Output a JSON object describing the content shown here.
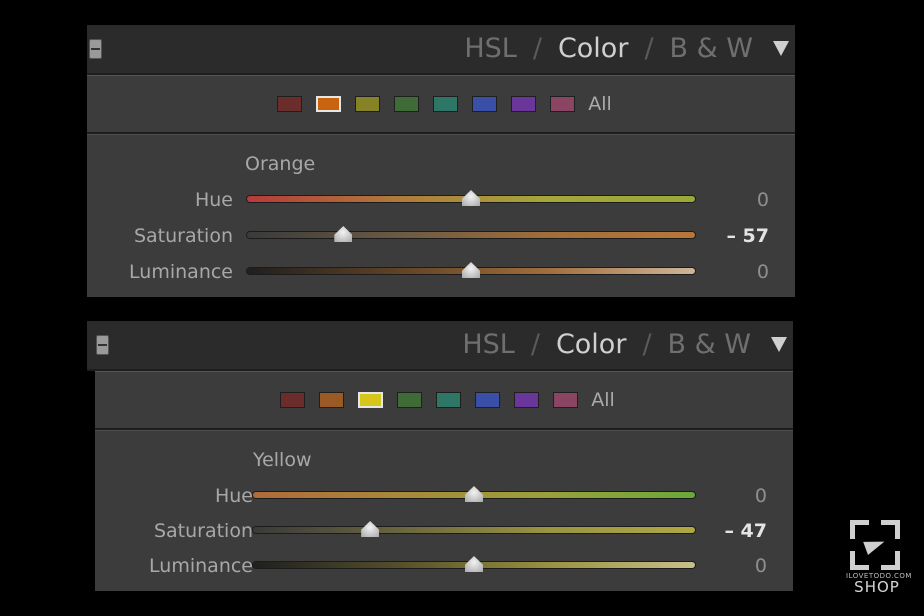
{
  "panels": [
    {
      "tabs": [
        "HSL",
        "Color",
        "B & W"
      ],
      "active_tab": 1,
      "separator": "/",
      "swatches": [
        {
          "color": "#6b2c2c",
          "selected": false
        },
        {
          "color": "#c8630f",
          "selected": true
        },
        {
          "color": "#868226",
          "selected": false
        },
        {
          "color": "#3f6b36",
          "selected": false
        },
        {
          "color": "#2e7766",
          "selected": false
        },
        {
          "color": "#3a4fa8",
          "selected": false
        },
        {
          "color": "#6a3699",
          "selected": false
        },
        {
          "color": "#8a4563",
          "selected": false
        }
      ],
      "all_label": "All",
      "color_name": "Orange",
      "sliders": [
        {
          "label": "Hue",
          "value_text": "0",
          "value": 0,
          "highlight": false,
          "gradient": [
            "#b63a3a",
            "#b07a3a",
            "#a5a63a",
            "#9aa83a"
          ]
        },
        {
          "label": "Saturation",
          "value_text": "– 57",
          "value": -57,
          "highlight": true,
          "gradient": [
            "#3a3a3a",
            "#6a5a44",
            "#a06e3a",
            "#b9773a"
          ]
        },
        {
          "label": "Luminance",
          "value_text": "0",
          "value": 0,
          "highlight": false,
          "gradient": [
            "#1f1f1f",
            "#5f4225",
            "#a06d3c",
            "#d0b59a"
          ]
        }
      ]
    },
    {
      "tabs": [
        "HSL",
        "Color",
        "B & W"
      ],
      "active_tab": 1,
      "separator": "/",
      "swatches": [
        {
          "color": "#6b2c2c",
          "selected": false
        },
        {
          "color": "#9a5a25",
          "selected": false
        },
        {
          "color": "#d6c51a",
          "selected": true
        },
        {
          "color": "#3f6b36",
          "selected": false
        },
        {
          "color": "#2e7766",
          "selected": false
        },
        {
          "color": "#3a4fa8",
          "selected": false
        },
        {
          "color": "#6a3699",
          "selected": false
        },
        {
          "color": "#8a4563",
          "selected": false
        }
      ],
      "all_label": "All",
      "color_name": "Yellow",
      "sliders": [
        {
          "label": "Hue",
          "value_text": "0",
          "value": 0,
          "highlight": false,
          "gradient": [
            "#b06a3a",
            "#a8893a",
            "#9aa03a",
            "#6aa83a"
          ]
        },
        {
          "label": "Saturation",
          "value_text": "– 47",
          "value": -47,
          "highlight": true,
          "gradient": [
            "#3a3a3a",
            "#6a6640",
            "#9a9440",
            "#b0a842"
          ]
        },
        {
          "label": "Luminance",
          "value_text": "0",
          "value": 0,
          "highlight": false,
          "gradient": [
            "#1f1f1f",
            "#55502a",
            "#999040",
            "#c8c08a"
          ]
        }
      ]
    }
  ],
  "watermark": {
    "small_text": "ILOVETODO.COM",
    "shop_text": "SHOP"
  }
}
